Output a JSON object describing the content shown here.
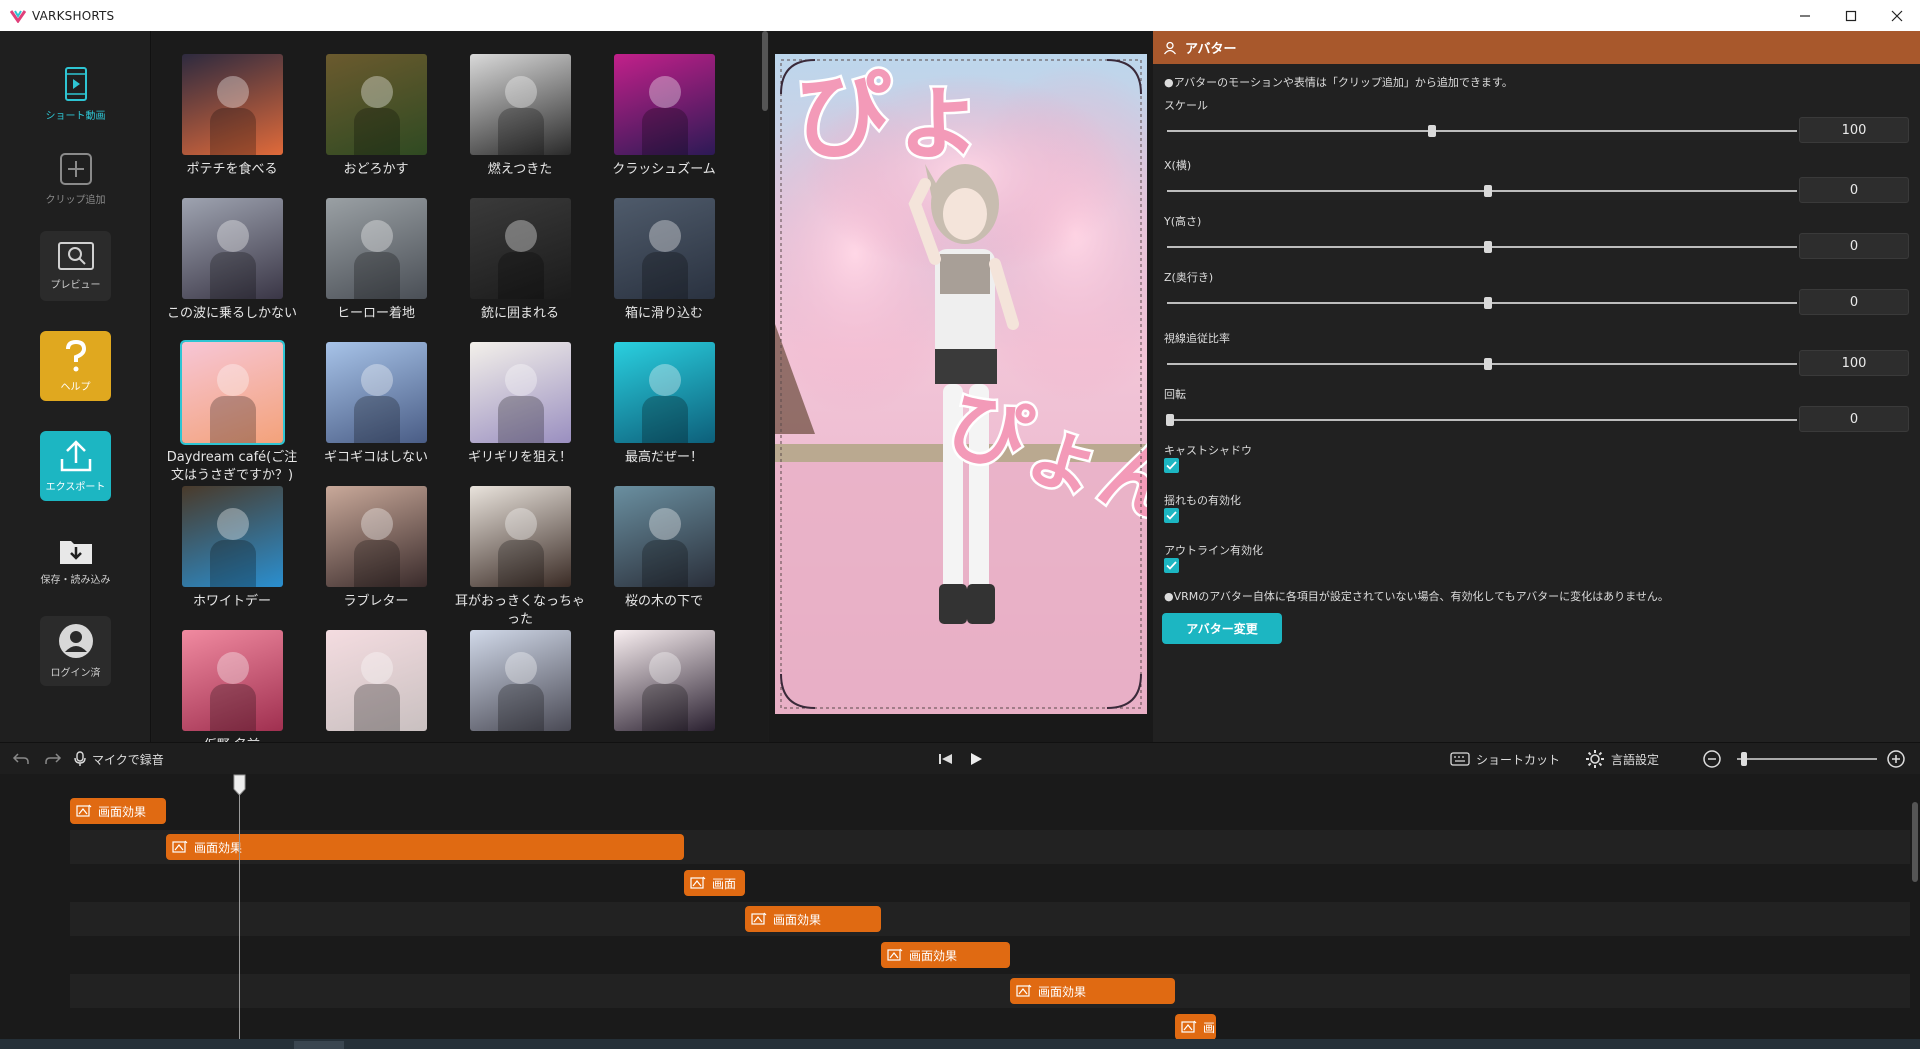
{
  "app": {
    "title": "VARKSHORTS"
  },
  "sidebar": [
    {
      "label": "ショート動画"
    },
    {
      "label": "クリップ追加"
    },
    {
      "label": "プレビュー"
    },
    {
      "label": "ヘルプ"
    },
    {
      "label": "エクスポート"
    },
    {
      "label": "保存・読み込み"
    },
    {
      "label": "ログイン済"
    }
  ],
  "clips": [
    {
      "name": "ポテチを食べる",
      "c1": "#2d2a3f",
      "c2": "#e06a3a"
    },
    {
      "name": "おどろかす",
      "c1": "#6b5a2e",
      "c2": "#2f4a22"
    },
    {
      "name": "燃えつきた",
      "c1": "#d9d9d9",
      "c2": "#2a2a2a"
    },
    {
      "name": "クラッシュズーム",
      "c1": "#c2208a",
      "c2": "#2c1a55"
    },
    {
      "name": "この波に乗るしかない",
      "c1": "#9ea3b0",
      "c2": "#3a3646"
    },
    {
      "name": "ヒーロー着地",
      "c1": "#9aa0a4",
      "c2": "#4a4f56"
    },
    {
      "name": "銃に囲まれる",
      "c1": "#3a3a3a",
      "c2": "#1b1b1b"
    },
    {
      "name": "箱に滑り込む",
      "c1": "#4f5b6b",
      "c2": "#2a3240"
    },
    {
      "name": "Daydream café(ご注文はうさぎですか？)",
      "c1": "#f7c6d6",
      "c2": "#f3a27a"
    },
    {
      "name": "ギコギコはしない",
      "c1": "#a7c3e8",
      "c2": "#4a5d86"
    },
    {
      "name": "ギリギリを狙え！",
      "c1": "#f3f0ea",
      "c2": "#9a8fc0"
    },
    {
      "name": "最高だぜー！",
      "c1": "#2ad0e0",
      "c2": "#0d5f7a"
    },
    {
      "name": "ホワイトデー",
      "c1": "#4a3a2a",
      "c2": "#2a8fd0"
    },
    {
      "name": "ラブレター",
      "c1": "#c9a99a",
      "c2": "#3a2b2b"
    },
    {
      "name": "耳がおっきくなっちゃった",
      "c1": "#e9e3dc",
      "c2": "#3a2b25"
    },
    {
      "name": "桜の木の下で",
      "c1": "#6a8fa0",
      "c2": "#2a2f3a"
    },
    {
      "name": "仮野 名前",
      "c1": "#f08aa0",
      "c2": "#a03050"
    },
    {
      "name": "",
      "c1": "#f4dce0",
      "c2": "#c9c0c0"
    },
    {
      "name": "",
      "c1": "#d0d8e8",
      "c2": "#4a4a55"
    },
    {
      "name": "",
      "c1": "#f8eef0",
      "c2": "#2a2030"
    }
  ],
  "properties": {
    "title": "アバター",
    "note": "●アバターのモーションや表情は「クリップ追加」から追加できます。",
    "sliders": [
      {
        "label": "スケール",
        "value": "100",
        "pos": 0.42
      },
      {
        "label": "X(横)",
        "value": "0",
        "pos": 0.51
      },
      {
        "label": "Y(高さ)",
        "value": "0",
        "pos": 0.51
      },
      {
        "label": "Z(奥行き)",
        "value": "0",
        "pos": 0.51
      },
      {
        "label": "視線追従比率",
        "value": "100",
        "pos": 0.51
      },
      {
        "label": "回転",
        "value": "0",
        "pos": 0.005
      }
    ],
    "checks": [
      {
        "label": "キャストシャドウ",
        "checked": true
      },
      {
        "label": "揺れもの有効化",
        "checked": true
      },
      {
        "label": "アウトライン有効化",
        "checked": true
      }
    ],
    "vrm_note": "●VRMのアバター自体に各項目が設定されていない場合、有効化してもアバターに変化はありません。",
    "button": "アバター変更"
  },
  "toolbar": {
    "record": "マイクで録音",
    "shortcut": "ショートカット",
    "language": "言語設定",
    "zoom": 0.05
  },
  "preview": {
    "text_top": "ぴょ",
    "text_bottom": "ぴょん"
  },
  "timeline": {
    "clips": [
      {
        "label": "画面効果",
        "start": 0,
        "end": 96
      },
      {
        "label": "画面効果",
        "start": 96,
        "end": 614
      },
      {
        "label": "画面",
        "start": 614,
        "end": 675
      },
      {
        "label": "画面効果",
        "start": 675,
        "end": 811
      },
      {
        "label": "画面効果",
        "start": 811,
        "end": 940
      },
      {
        "label": "画面効果",
        "start": 940,
        "end": 1105
      },
      {
        "label": "画",
        "start": 1105,
        "end": 1146
      }
    ]
  },
  "colors": {
    "accent": "#1cb6c2",
    "help": "#e0a81f",
    "header": "#a8582c",
    "clip": "#e06a12"
  }
}
